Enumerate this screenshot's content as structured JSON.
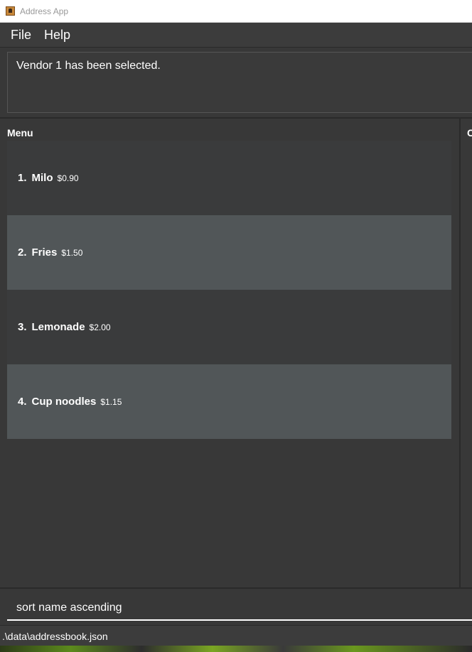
{
  "window": {
    "title": "Address App"
  },
  "menubar": {
    "file": "File",
    "help": "Help"
  },
  "result": {
    "message": "Vendor 1 has been selected."
  },
  "menu_panel": {
    "title": "Menu",
    "items": [
      {
        "index": "1.",
        "name": "Milo",
        "price": "$0.90"
      },
      {
        "index": "2.",
        "name": "Fries",
        "price": "$1.50"
      },
      {
        "index": "3.",
        "name": "Lemonade",
        "price": "$2.00"
      },
      {
        "index": "4.",
        "name": "Cup noodles",
        "price": "$1.15"
      }
    ]
  },
  "right_panel": {
    "title_partial": "C"
  },
  "command": {
    "value": "sort name ascending"
  },
  "status": {
    "path": ".\\data\\addressbook.json"
  },
  "colors": {
    "background": "#383838",
    "row_dark": "#3a3b3c",
    "row_light": "#515658",
    "text": "#ffffff"
  }
}
